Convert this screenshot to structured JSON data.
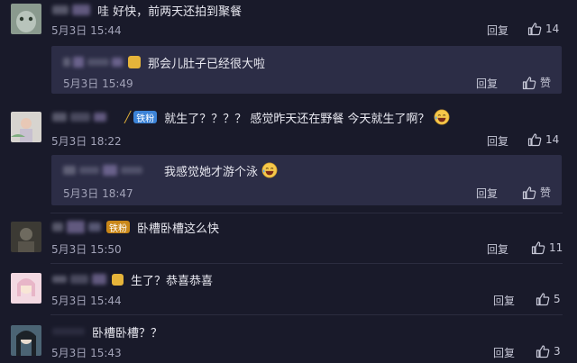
{
  "comments": [
    {
      "text": "哇 好快，前两天还拍到聚餐",
      "time": "5月3日 15:44",
      "reply_label": "回复",
      "likes": "14"
    },
    {
      "text": "就生了？？？？ 感觉昨天还在野餐 今天就生了啊？",
      "badge": "铁粉",
      "time": "5月3日 18:22",
      "reply_label": "回复",
      "likes": "14"
    },
    {
      "text": "卧槽卧槽这么快",
      "badge": "铁粉",
      "time": "5月3日 15:50",
      "reply_label": "回复",
      "likes": "11"
    },
    {
      "text": "生了？恭喜恭喜",
      "time": "5月3日 15:44",
      "reply_label": "回复",
      "likes": "5"
    },
    {
      "text": "卧槽卧槽？？",
      "time": "5月3日 15:43",
      "reply_label": "回复",
      "likes": "3"
    }
  ],
  "replies": [
    {
      "text": "那会儿肚子已经很大啦",
      "time": "5月3日 15:49",
      "reply_label": "回复",
      "like_label": "赞"
    },
    {
      "text": "我感觉她才游个泳",
      "time": "5月3日 18:47",
      "reply_label": "回复",
      "like_label": "赞"
    }
  ],
  "colors": {
    "background": "#191a2a",
    "reply_box": "#2c2d46",
    "text": "#e8e8f0",
    "muted": "#a2a3b8",
    "badge_blue": "#3c83d7"
  },
  "icons": {
    "like": "thumbs-up-icon",
    "emoji_smile": "smiling-face-icon",
    "emoji_laugh": "laughing-face-icon"
  }
}
